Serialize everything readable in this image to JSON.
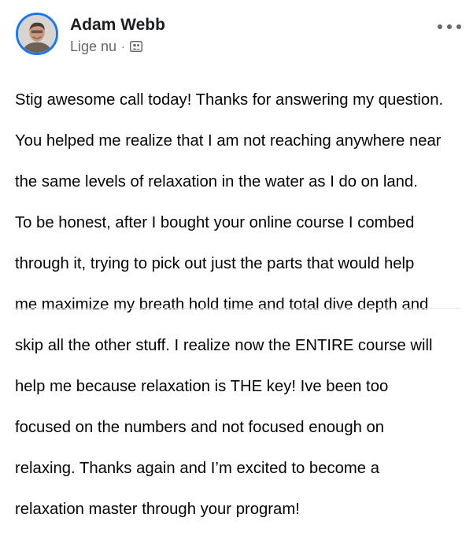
{
  "post": {
    "author": {
      "name": "Adam Webb",
      "avatar_icon": "profile-photo"
    },
    "meta": {
      "timestamp": "Lige nu",
      "separator": "·",
      "audience_icon": "group-audience-icon"
    },
    "more_icon": "more-options-icon",
    "body_lines": [
      "Stig awesome call today! Thanks for answering my question.",
      "You helped me realize that I am not reaching anywhere near",
      "the same levels of relaxation in the water as I do on land.",
      "To be honest, after I bought your online course I combed",
      "through it, trying to pick out just the parts that would help",
      "me maximize my breath hold time and total dive depth and",
      "skip all the other stuff. I realize now the ENTIRE course will",
      "help me because relaxation is THE key! Ive been too",
      "focused on the numbers and not focused enough on",
      "relaxing. Thanks again and I’m excited to become a",
      "relaxation master through your program!"
    ]
  },
  "colors": {
    "accent": "#1877f2",
    "secondary_text": "#65676b",
    "primary_text": "#050505"
  }
}
